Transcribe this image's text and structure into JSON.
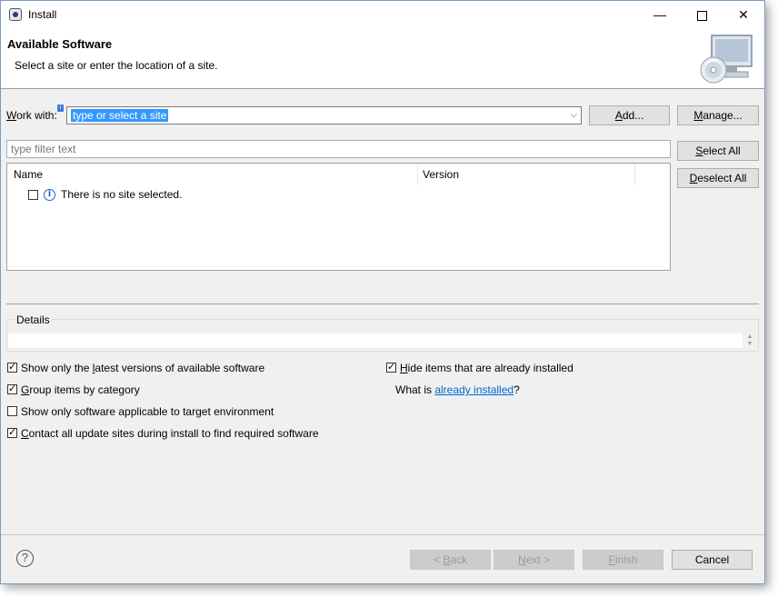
{
  "window": {
    "title": "Install",
    "minimize_glyph": "—",
    "close_glyph": "✕"
  },
  "header": {
    "title": "Available Software",
    "description": "Select a site or enter the location of a site."
  },
  "work_with": {
    "label_underlined": "W",
    "label_rest": "ork with:",
    "value": "type or select a site",
    "add_button_pre": "",
    "add_button_u": "A",
    "add_button_post": "dd...",
    "manage_button_pre": "",
    "manage_button_u": "M",
    "manage_button_post": "anage..."
  },
  "filter": {
    "placeholder": "type filter text"
  },
  "buttons": {
    "select_all_pre": "",
    "select_all_u": "S",
    "select_all_post": "elect All",
    "deselect_all_pre": "",
    "deselect_all_u": "D",
    "deselect_all_post": "eselect All"
  },
  "table": {
    "columns": [
      "Name",
      "Version"
    ],
    "rows": [
      {
        "name": "There is no site selected.",
        "checked": false
      }
    ]
  },
  "details": {
    "label": "Details"
  },
  "options": {
    "latest_versions": {
      "pre": "Show only the ",
      "u": "l",
      "post": "atest versions of available software",
      "checked": true
    },
    "group_by_category": {
      "pre": "",
      "u": "G",
      "post": "roup items by category",
      "checked": true
    },
    "target_env": {
      "pre": "Show only software applicable to target environment",
      "u": "",
      "post": "",
      "checked": false
    },
    "contact_sites": {
      "pre": "",
      "u": "C",
      "post": "ontact all update sites during install to find required software",
      "checked": true
    },
    "hide_installed": {
      "pre": "",
      "u": "H",
      "post": "ide items that are already installed",
      "checked": true
    }
  },
  "already_installed": {
    "prefix": "What is ",
    "link": "already installed",
    "suffix": "?"
  },
  "footer": {
    "help_glyph": "?",
    "back_pre": "< ",
    "back_u": "B",
    "back_post": "ack",
    "next_pre": "",
    "next_u": "N",
    "next_post": "ext >",
    "finish_pre": "",
    "finish_u": "F",
    "finish_post": "inish",
    "cancel": "Cancel"
  }
}
